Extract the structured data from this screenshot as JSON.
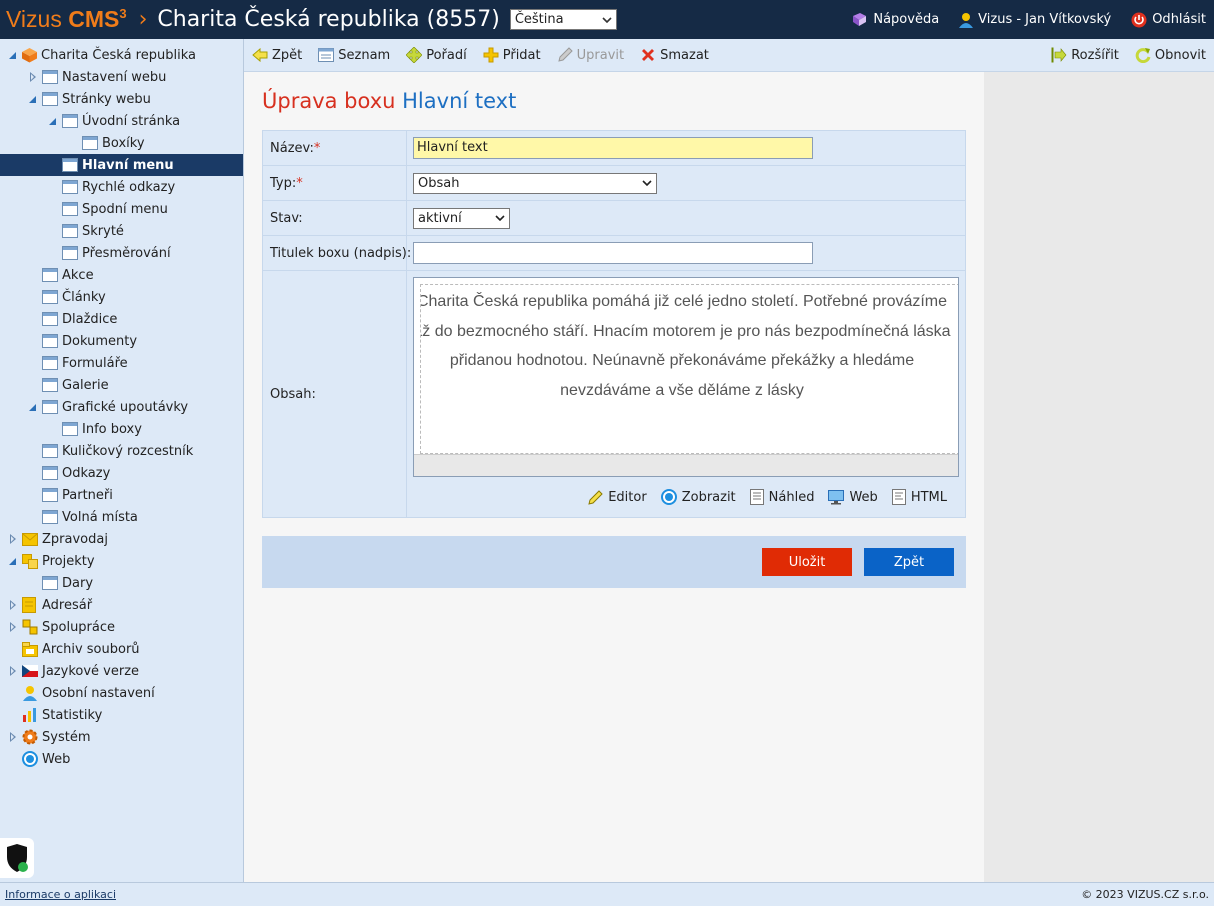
{
  "header": {
    "brand_name": "Vizus",
    "brand_product": "CMS",
    "brand_sup": "3",
    "chevron": "›",
    "site_title": "Charita Česká republika (8557)",
    "language": "Čeština",
    "help": "Nápověda",
    "user": "Vizus - Jan Vítkovský",
    "logout": "Odhlásit"
  },
  "sidebar": {
    "root": "Charita Česká republika",
    "items": [
      {
        "label": "Nastavení webu"
      },
      {
        "label": "Stránky webu"
      },
      {
        "label": "Úvodní stránka"
      },
      {
        "label": "Boxíky"
      },
      {
        "label": "Hlavní menu"
      },
      {
        "label": "Rychlé odkazy"
      },
      {
        "label": "Spodní menu"
      },
      {
        "label": "Skryté"
      },
      {
        "label": "Přesměrování"
      },
      {
        "label": "Akce"
      },
      {
        "label": "Články"
      },
      {
        "label": "Dlaždice"
      },
      {
        "label": "Dokumenty"
      },
      {
        "label": "Formuláře"
      },
      {
        "label": "Galerie"
      },
      {
        "label": "Grafické upoutávky"
      },
      {
        "label": "Info boxy"
      },
      {
        "label": "Kuličkový rozcestník"
      },
      {
        "label": "Odkazy"
      },
      {
        "label": "Partneři"
      },
      {
        "label": "Volná místa"
      },
      {
        "label": "Zpravodaj"
      },
      {
        "label": "Projekty"
      },
      {
        "label": "Dary"
      },
      {
        "label": "Adresář"
      },
      {
        "label": "Spolupráce"
      },
      {
        "label": "Archiv souborů"
      },
      {
        "label": "Jazykové verze"
      },
      {
        "label": "Osobní nastavení"
      },
      {
        "label": "Statistiky"
      },
      {
        "label": "Systém"
      },
      {
        "label": "Web"
      }
    ]
  },
  "toolbar": {
    "back": "Zpět",
    "list": "Seznam",
    "order": "Pořadí",
    "add": "Přidat",
    "edit": "Upravit",
    "delete": "Smazat",
    "expand": "Rozšířit",
    "refresh": "Obnovit"
  },
  "page": {
    "heading_prefix": "Úprava boxu",
    "heading_name": "Hlavní text"
  },
  "form": {
    "name_label": "Název:",
    "name_value": "Hlavní text",
    "type_label": "Typ:",
    "type_value": "Obsah",
    "status_label": "Stav:",
    "status_value": "aktivní",
    "title_label": "Titulek boxu (nadpis):",
    "title_value": "",
    "content_label": "Obsah:",
    "required_mark": "*",
    "content_lines": [
      "Charita Česká republika pomáhá již celé jedno století. Potřebné provázíme",
      "až do bezmocného stáří. Hnacím motorem je pro nás bezpodmínečná láska",
      "přidanou hodnotou. Neúnavně překonáváme překážky a hledáme",
      "nevzdáváme a vše děláme z lásky"
    ],
    "modes": {
      "editor": "Editor",
      "show": "Zobrazit",
      "preview": "Náhled",
      "web": "Web",
      "html": "HTML"
    }
  },
  "actions": {
    "save": "Uložit",
    "back": "Zpět"
  },
  "footer": {
    "app_info": "Informace o aplikaci",
    "copyright": "© 2023 VIZUS.CZ s.r.o."
  }
}
